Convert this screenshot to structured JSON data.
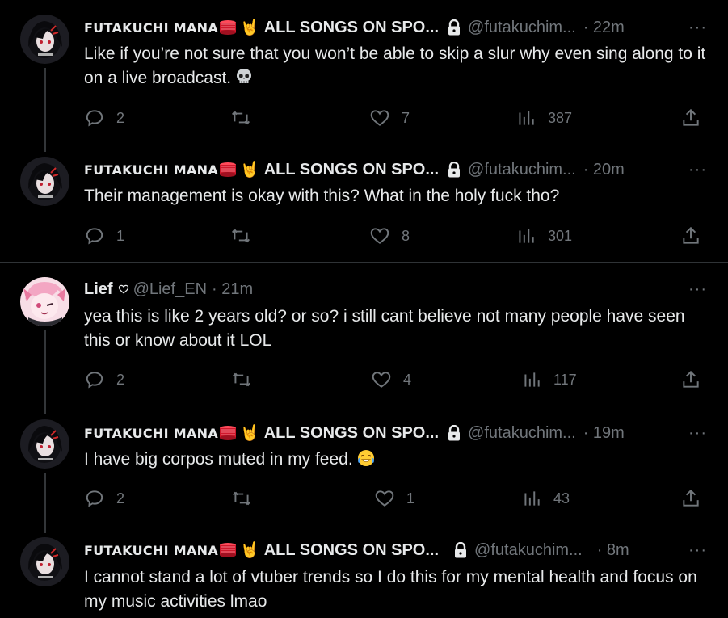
{
  "tweets": [
    {
      "display_name": "FUTAKUCHI MANA",
      "name_suffix": "ALL SONGS ON SPO...",
      "handle": "@futakuchim...",
      "time": "· 22m",
      "text": "Like if you’re not sure that you won’t be able to skip a slur why even sing along to it on a live broadcast.",
      "emoji": "skull-emoji",
      "replies": "2",
      "retweets": "",
      "likes": "7",
      "views": "387"
    },
    {
      "display_name": "FUTAKUCHI MANA",
      "name_suffix": "ALL SONGS ON SPO...",
      "handle": "@futakuchim...",
      "time": "· 20m",
      "text": "Their management is okay with this? What in the holy fuck tho?",
      "replies": "1",
      "retweets": "",
      "likes": "8",
      "views": "301"
    },
    {
      "display_name": "Lief",
      "handle": "@Lief_EN",
      "time": "· 21m",
      "text": "yea this is like 2 years old? or so? i still cant believe not many people have seen this or know about it LOL",
      "replies": "2",
      "retweets": "",
      "likes": "4",
      "views": "117"
    },
    {
      "display_name": "FUTAKUCHI MANA",
      "name_suffix": "ALL SONGS ON SPO...",
      "handle": "@futakuchim...",
      "time": "· 19m",
      "text": "I have big corpos muted in my feed.",
      "emoji": "tears-of-joy-emoji",
      "replies": "2",
      "retweets": "",
      "likes": "1",
      "views": "43"
    },
    {
      "display_name": "FUTAKUCHI MANA",
      "name_suffix": "ALL SONGS ON SPO...",
      "handle": "@futakuchim...",
      "time": "· 8m",
      "text": "I cannot stand a lot of vtuber trends so I do this for my mental health and focus on my music activities lmao"
    }
  ],
  "more_label": "···",
  "colors": {
    "background": "#000000",
    "text": "#e7e9ea",
    "muted": "#71767b",
    "divider": "#2f3336"
  }
}
